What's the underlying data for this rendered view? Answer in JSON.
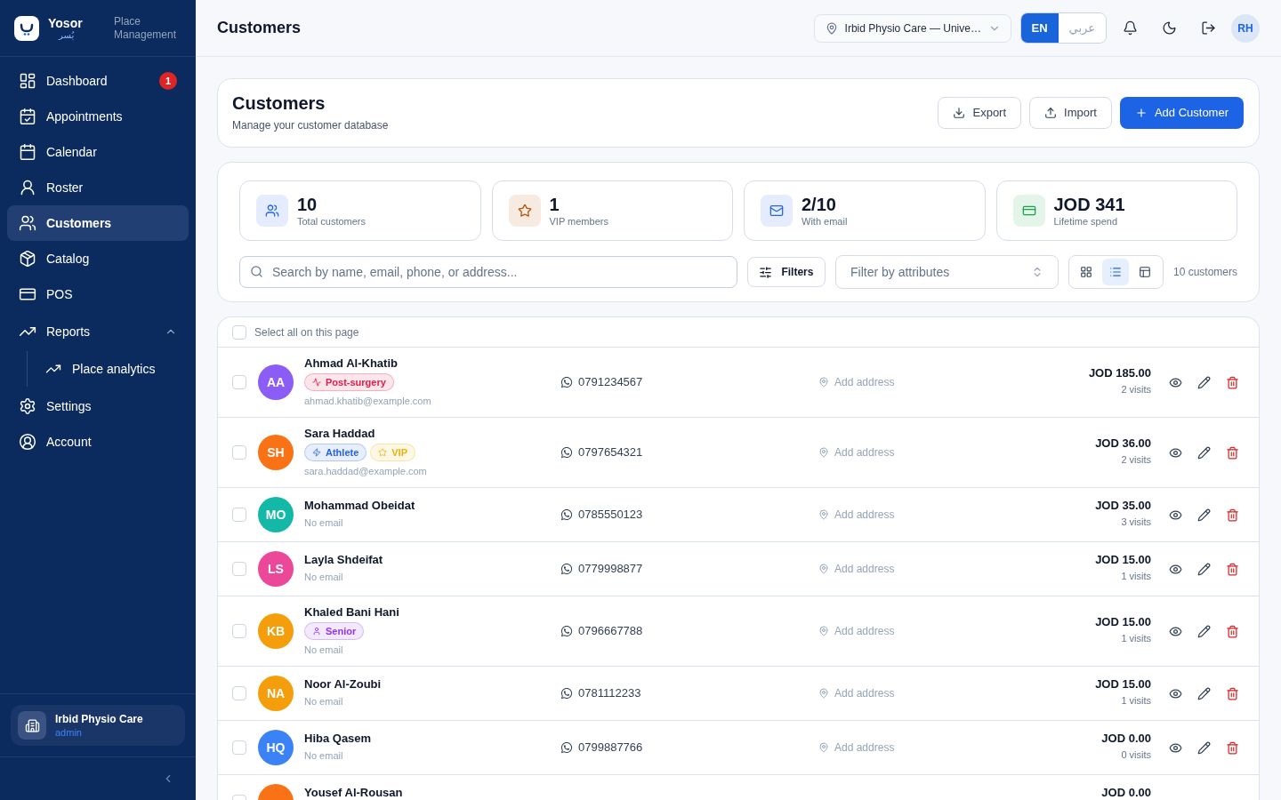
{
  "sidebar": {
    "brand": {
      "name": "Yosor",
      "name_ar": "يُسر",
      "tagline": "Place Management"
    },
    "items": [
      {
        "label": "Dashboard",
        "kind": "dashboard",
        "selected": false,
        "badge": "1"
      },
      {
        "label": "Appointments",
        "kind": "appointments",
        "selected": false
      },
      {
        "label": "Calendar",
        "kind": "calendar",
        "selected": false
      },
      {
        "label": "Roster",
        "kind": "roster",
        "selected": false
      },
      {
        "label": "Customers",
        "kind": "customers",
        "selected": true
      },
      {
        "label": "Catalog",
        "kind": "catalog",
        "selected": false
      },
      {
        "label": "POS",
        "kind": "pos",
        "selected": false
      },
      {
        "label": "Reports",
        "kind": "reports",
        "selected": false,
        "expanded": true,
        "children": [
          {
            "label": "Place analytics",
            "kind": "reports",
            "selected": false
          }
        ]
      },
      {
        "label": "Settings",
        "kind": "settings",
        "selected": false
      },
      {
        "label": "Account",
        "kind": "account",
        "selected": false
      }
    ],
    "place_card": {
      "name": "Irbid Physio Care",
      "role": "admin"
    }
  },
  "header": {
    "title": "Customers",
    "place_select": "Irbid Physio Care — Unive…",
    "languages": [
      {
        "label": "EN",
        "selected": true
      },
      {
        "label": "عربي",
        "selected": false
      }
    ],
    "user_initials": "RH"
  },
  "page_card": {
    "title": "Customers",
    "subtitle": "Manage your customer database",
    "buttons": [
      {
        "label": "Export",
        "kind": "export"
      },
      {
        "label": "Import",
        "kind": "import"
      },
      {
        "label": "Add Customer",
        "kind": "add"
      }
    ]
  },
  "stats": [
    {
      "value": "10",
      "label": "Total customers",
      "kind": "users",
      "color": "#2563eb"
    },
    {
      "value": "1",
      "label": "VIP members",
      "kind": "star",
      "color": "#b45309"
    },
    {
      "value": "2/10",
      "label": "With email",
      "kind": "mail",
      "color": "#2563eb"
    },
    {
      "value": "JOD 341",
      "label": "Lifetime spend",
      "kind": "card",
      "color": "#16a34a"
    }
  ],
  "toolbar": {
    "search": {
      "placeholder": "Search by name, email, phone, or address..."
    },
    "filters_button": "Filters",
    "attribute_filter": {
      "placeholder": "Filter by attributes"
    },
    "views": [
      {
        "kind": "grid",
        "selected": false
      },
      {
        "kind": "list",
        "selected": true
      },
      {
        "kind": "table",
        "selected": false
      }
    ],
    "count": "10 customers"
  },
  "list": {
    "select_all": {
      "label": "Select all on this page",
      "checked": false
    },
    "customers": [
      {
        "initials": "AA",
        "color": "#8b5cf6",
        "name": "Ahmad Al-Khatib",
        "checked": false,
        "tags": [
          {
            "label": "Post-surgery",
            "kind": "pulse",
            "color": "#e11d48"
          }
        ],
        "email": "ahmad.khatib@example.com",
        "phone": "0791234567",
        "address": "Add address",
        "amount": "JOD 185.00",
        "visits": "2 visits"
      },
      {
        "initials": "SH",
        "color": "#f97316",
        "name": "Sara Haddad",
        "checked": false,
        "tags": [
          {
            "label": "Athlete",
            "kind": "bolt",
            "color": "#2563eb"
          },
          {
            "label": "VIP",
            "kind": "star",
            "color": "#eab308"
          }
        ],
        "email": "sara.haddad@example.com",
        "phone": "0797654321",
        "address": "Add address",
        "amount": "JOD 36.00",
        "visits": "2 visits"
      },
      {
        "initials": "MO",
        "color": "#14b8a6",
        "name": "Mohammad Obeidat",
        "checked": false,
        "email": "No email",
        "phone": "0785550123",
        "address": "Add address",
        "amount": "JOD 35.00",
        "visits": "3 visits"
      },
      {
        "initials": "LS",
        "color": "#ec4899",
        "name": "Layla Shdeifat",
        "checked": false,
        "email": "No email",
        "phone": "0779998877",
        "address": "Add address",
        "amount": "JOD 15.00",
        "visits": "1 visits"
      },
      {
        "initials": "KB",
        "color": "#f59e0b",
        "name": "Khaled Bani Hani",
        "checked": false,
        "tags": [
          {
            "label": "Senior",
            "kind": "person",
            "color": "#9333ea"
          }
        ],
        "email": "No email",
        "phone": "0796667788",
        "address": "Add address",
        "amount": "JOD 15.00",
        "visits": "1 visits"
      },
      {
        "initials": "NA",
        "color": "#f59e0b",
        "name": "Noor Al-Zoubi",
        "checked": false,
        "email": "No email",
        "phone": "0781112233",
        "address": "Add address",
        "amount": "JOD 15.00",
        "visits": "1 visits"
      },
      {
        "initials": "HQ",
        "color": "#3b82f6",
        "name": "Hiba Qasem",
        "checked": false,
        "email": "No email",
        "phone": "0799887766",
        "address": "Add address",
        "amount": "JOD 0.00",
        "visits": "0 visits"
      },
      {
        "color": "#f97316",
        "name": "Yousef Al-Rousan",
        "checked": false,
        "amount": "JOD 0.00"
      }
    ]
  }
}
